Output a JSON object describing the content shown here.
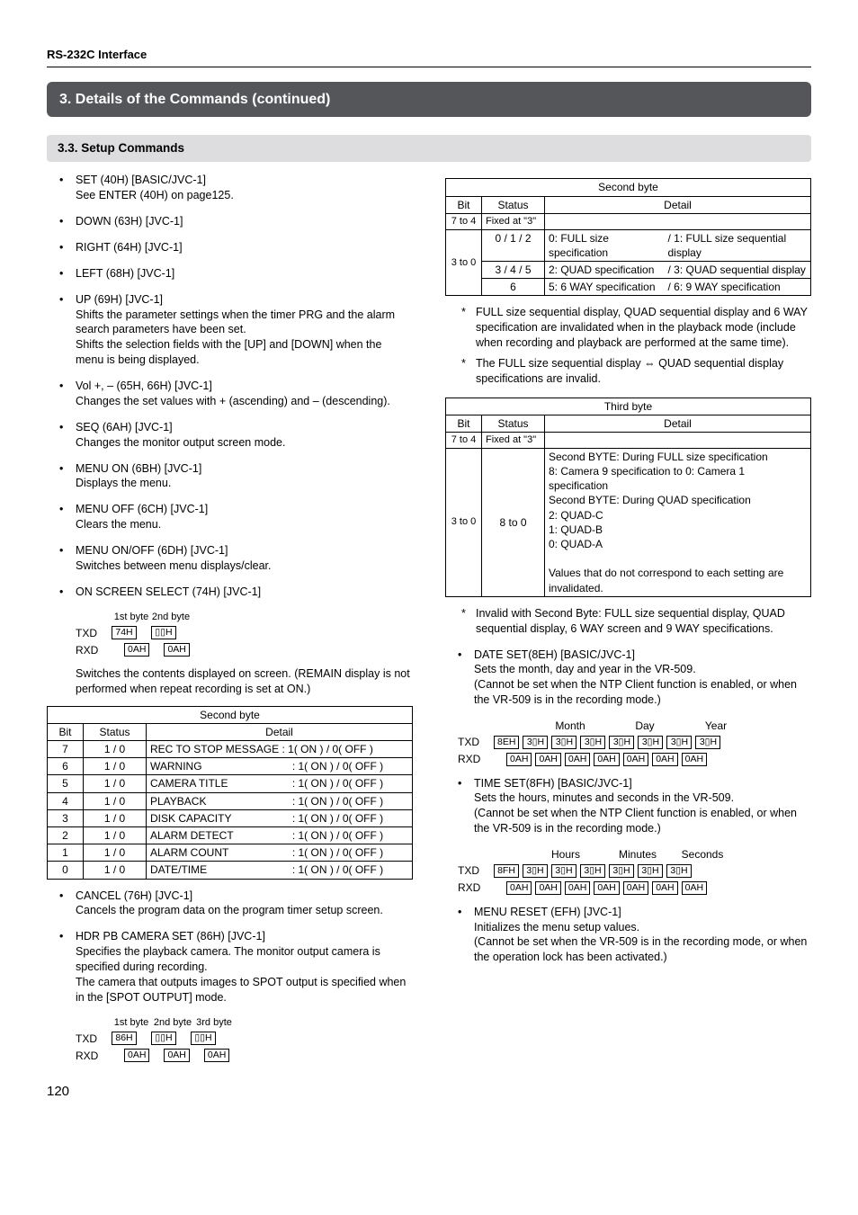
{
  "page_number": "120",
  "header": "RS-232C Interface",
  "section_bar": "3. Details of the Commands (continued)",
  "subsection": "3.3. Setup Commands",
  "left": {
    "items": [
      {
        "title": "SET (40H) [BASIC/JVC-1]",
        "desc": "See ENTER (40H) on page125."
      },
      {
        "title": "DOWN    (63H) [JVC-1]"
      },
      {
        "title": "RIGHT   (64H) [JVC-1]"
      },
      {
        "title": "LEFT     (68H) [JVC-1]"
      },
      {
        "title": "UP          (69H) [JVC-1]",
        "desc": "Shifts the parameter settings when the timer PRG and the alarm search parameters have been set.\nShifts the selection fields with the [UP] and [DOWN] when the menu is being displayed."
      },
      {
        "title": "Vol +, – (65H, 66H) [JVC-1]",
        "desc": "Changes the set values with + (ascending) and – (descending)."
      },
      {
        "title": "SEQ (6AH) [JVC-1]",
        "desc": "Changes the monitor output screen mode."
      },
      {
        "title": "MENU ON (6BH) [JVC-1]",
        "desc": "Displays the menu."
      },
      {
        "title": "MENU OFF (6CH) [JVC-1]",
        "desc": "Clears the menu."
      },
      {
        "title": "MENU ON/OFF (6DH) [JVC-1]",
        "desc": "Switches between menu displays/clear."
      },
      {
        "title": "ON SCREEN SELECT (74H) [JVC-1]"
      }
    ],
    "onscreen_diag": {
      "col_labels": [
        "1st byte",
        "2nd byte"
      ],
      "txd": [
        "74H",
        "▯▯H"
      ],
      "rxd": [
        "0AH",
        "0AH"
      ]
    },
    "onscreen_text": "Switches the contents displayed on screen. (REMAIN display is not performed when repeat recording is set at ON.)",
    "second_byte_table": {
      "title": "Second byte",
      "headers": [
        "Bit",
        "Status",
        "Detail"
      ],
      "rows": [
        [
          "7",
          "1 / 0",
          "REC TO STOP MESSAGE : 1( ON ) / 0( OFF )"
        ],
        [
          "6",
          "1 / 0",
          "WARNING",
          ": 1( ON ) / 0( OFF )"
        ],
        [
          "5",
          "1 / 0",
          "CAMERA TITLE",
          ": 1( ON ) / 0( OFF )"
        ],
        [
          "4",
          "1 / 0",
          "PLAYBACK",
          ": 1( ON ) / 0( OFF )"
        ],
        [
          "3",
          "1 / 0",
          "DISK CAPACITY",
          ": 1( ON ) / 0( OFF )"
        ],
        [
          "2",
          "1 / 0",
          "ALARM DETECT",
          ": 1( ON ) / 0( OFF )"
        ],
        [
          "1",
          "1 / 0",
          "ALARM COUNT",
          ": 1( ON ) / 0( OFF )"
        ],
        [
          "0",
          "1 / 0",
          "DATE/TIME",
          ": 1( ON ) / 0( OFF )"
        ]
      ]
    },
    "cancel": {
      "title": "CANCEL (76H) [JVC-1]",
      "desc": "Cancels the program data on the program timer setup screen."
    },
    "hdr": {
      "title": "HDR PB CAMERA SET (86H) [JVC-1]",
      "desc": "Specifies the playback camera. The monitor output camera is specified during recording.\nThe camera that outputs images to SPOT output is specified when in the [SPOT OUTPUT] mode."
    },
    "hdr_diag": {
      "col_labels": [
        "1st byte",
        "2nd byte",
        "3rd byte"
      ],
      "txd": [
        "86H",
        "▯▯H",
        "▯▯H"
      ],
      "rxd": [
        "0AH",
        "0AH",
        "0AH"
      ]
    }
  },
  "right": {
    "second_byte_table": {
      "title": "Second byte",
      "headers": [
        "Bit",
        "Status",
        "Detail"
      ],
      "rows": [
        {
          "bit": "7 to 4",
          "status": "Fixed at \"3\"",
          "detail": ""
        },
        {
          "bit": "3 to 0",
          "sub": [
            {
              "status": "0 / 1 / 2",
              "d1": "0: FULL size specification",
              "d2": "/ 1: FULL size sequential display"
            },
            {
              "status": "3 / 4 / 5",
              "d1": "2: QUAD specification",
              "d2": "/ 3: QUAD sequential display"
            },
            {
              "status": "6",
              "d1": "5: 6 WAY specification",
              "d2": "/ 6: 9 WAY specification"
            }
          ]
        }
      ]
    },
    "notes1": [
      "FULL size sequential display, QUAD sequential display and 6 WAY specification are invalidated when in the playback mode (include when recording and playback are performed at the same time).",
      "The FULL size sequential display ⇔ QUAD sequential display specifications are invalid."
    ],
    "third_byte_table": {
      "title": "Third byte",
      "headers": [
        "Bit",
        "Status",
        "Detail"
      ],
      "row1": {
        "bit": "7 to 4",
        "status": "Fixed at \"3\"",
        "detail": ""
      },
      "row2": {
        "bit": "3 to 0",
        "status": "8 to 0",
        "detail": "Second BYTE: During FULL size specification\n8: Camera 9 specification to 0: Camera 1 specification\nSecond BYTE: During QUAD specification\n2: QUAD-C\n1: QUAD-B\n0: QUAD-A\n\nValues that do not correspond to each setting are invalidated."
      }
    },
    "notes2": [
      "Invalid with Second Byte: FULL size sequential display, QUAD sequential display, 6 WAY screen and 9 WAY specifications."
    ],
    "date_set": {
      "title": "DATE SET(8EH) [BASIC/JVC-1]",
      "desc": "Sets the month, day and year in the VR-509.\n(Cannot be set when the NTP Client function is enabled, or when the VR-509 is in the recording mode.)"
    },
    "date_diag": {
      "seg_labels": [
        "Month",
        "Day",
        "Year"
      ],
      "txd": [
        "8EH",
        "3▯H",
        "3▯H",
        "3▯H",
        "3▯H",
        "3▯H",
        "3▯H",
        "3▯H"
      ],
      "rxd": [
        "0AH",
        "0AH",
        "0AH",
        "0AH",
        "0AH",
        "0AH",
        "0AH"
      ]
    },
    "time_set": {
      "title": "TIME SET(8FH) [BASIC/JVC-1]",
      "desc": "Sets the hours, minutes and seconds in the VR-509.\n(Cannot be set when the NTP Client function is enabled, or when the VR-509 is in the recording mode.)"
    },
    "time_diag": {
      "seg_labels": [
        "Hours",
        "Minutes",
        "Seconds"
      ],
      "txd": [
        "8FH",
        "3▯H",
        "3▯H",
        "3▯H",
        "3▯H",
        "3▯H",
        "3▯H"
      ],
      "rxd": [
        "0AH",
        "0AH",
        "0AH",
        "0AH",
        "0AH",
        "0AH",
        "0AH"
      ]
    },
    "menu_reset": {
      "title": "MENU RESET (EFH) [JVC-1]",
      "desc": "Initializes the menu setup values.\n(Cannot be set when the VR-509 is in the recording mode, or when the operation lock has been activated.)"
    }
  }
}
